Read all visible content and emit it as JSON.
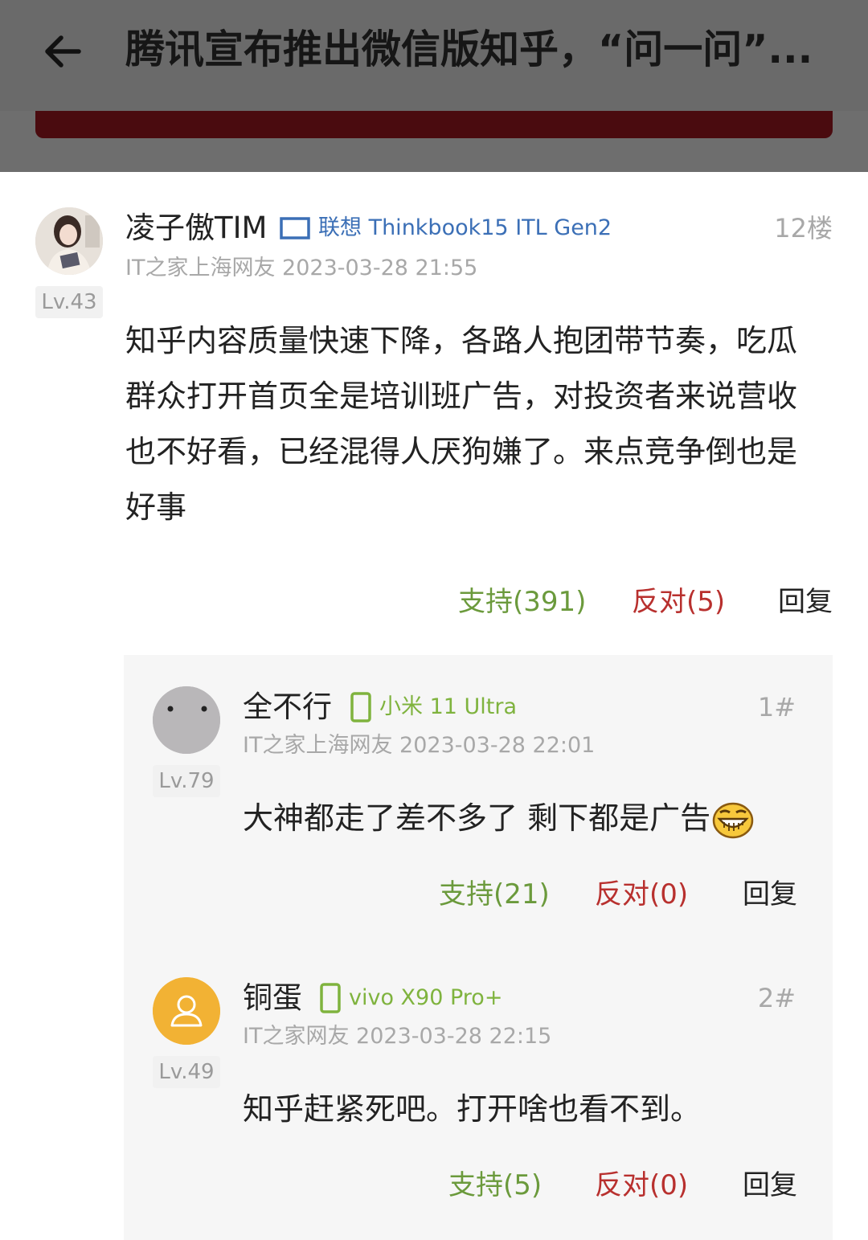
{
  "header": {
    "title": "腾讯宣布推出微信版知乎，“问一问”..."
  },
  "comment": {
    "username": "凌子傲TIM",
    "device": "联想 Thinkbook15 ITL Gen2",
    "meta": "IT之家上海网友 2023-03-28 21:55",
    "floor": "12楼",
    "level": "Lv.43",
    "content": "知乎内容质量快速下降，各路人抱团带节奏，吃瓜群众打开首页全是培训班广告，对投资者来说营收也不好看，已经混得人厌狗嫌了。来点竞争倒也是好事",
    "support": "支持(391)",
    "oppose": "反对(5)",
    "reply": "回复"
  },
  "replies": [
    {
      "username": "全不行",
      "device": "小米 11 Ultra",
      "meta": "IT之家上海网友 2023-03-28 22:01",
      "floor": "1#",
      "level": "Lv.79",
      "content": "大神都走了差不多了 剩下都是广告",
      "support": "支持(21)",
      "oppose": "反对(0)",
      "reply": "回复"
    },
    {
      "username": "铜蛋",
      "device": "vivo X90 Pro+",
      "meta": "IT之家网友 2023-03-28 22:15",
      "floor": "2#",
      "level": "Lv.49",
      "content": "知乎赶紧死吧。打开啥也看不到。",
      "support": "支持(5)",
      "oppose": "反对(0)",
      "reply": "回复"
    }
  ],
  "colors": {
    "support": "#6b9a3c",
    "oppose": "#b8302e",
    "device_laptop": "#3b6fb6",
    "device_phone": "#7fb33e",
    "avatar_orange": "#f2b234"
  }
}
